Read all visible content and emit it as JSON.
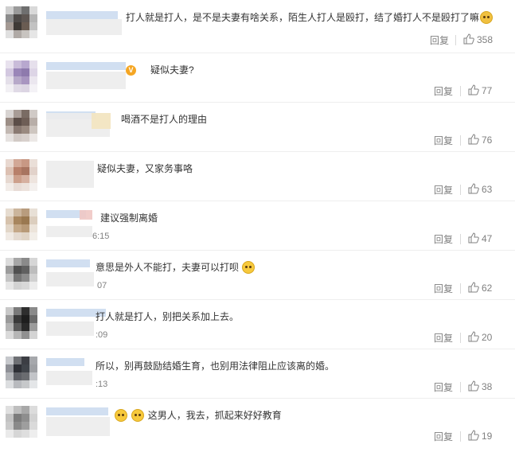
{
  "comments": [
    {
      "text": "打人就是打人，是不是夫妻有啥关系，陌生人打人是殴打，结了婚打人不是殴打了嘛",
      "trailing_emoji": "crying-emoji",
      "time": "",
      "reply": "回复",
      "likes": "358"
    },
    {
      "text": "疑似夫妻?",
      "verified_badge": "V",
      "time": "",
      "reply": "回复",
      "likes": "77"
    },
    {
      "text": "喝酒不是打人的理由",
      "time": "",
      "reply": "回复",
      "likes": "76"
    },
    {
      "text": "疑似夫妻，又家务事咯",
      "time": "",
      "reply": "回复",
      "likes": "63"
    },
    {
      "text": "建议强制离婚",
      "time": "6:15",
      "reply": "回复",
      "likes": "47"
    },
    {
      "text": "意思是外人不能打，夫妻可以打呗",
      "trailing_emoji": "smirk-emoji",
      "time": "07",
      "reply": "回复",
      "likes": "62"
    },
    {
      "text": "打人就是打人，别把关系加上去。",
      "time": ":09",
      "reply": "回复",
      "likes": "20"
    },
    {
      "text": "所以，别再鼓励结婚生育，也别用法律阻止应该离的婚。",
      "time": ":13",
      "reply": "回复",
      "likes": "38"
    },
    {
      "text": "这男人，我去，抓起来好好教育",
      "leading_emojis": [
        "pleading-emoji",
        "pleading-emoji"
      ],
      "time": "",
      "reply": "回复",
      "likes": "19"
    }
  ],
  "colors": {
    "reply": "#808080",
    "text": "#333333",
    "divider": "#eeeeee"
  }
}
